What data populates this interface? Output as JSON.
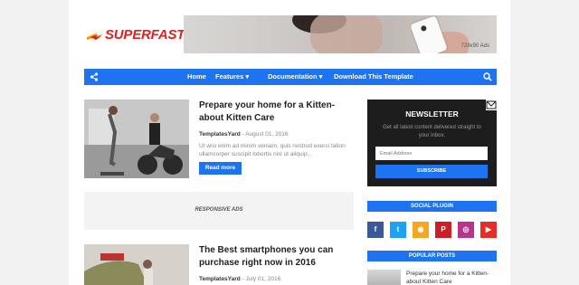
{
  "header": {
    "logo_text": "SUPERFAST",
    "banner_label": "728x90 Ads"
  },
  "nav": {
    "items": [
      "Home",
      "Features ▾",
      "Documentation ▾",
      "Download This Template"
    ]
  },
  "posts": [
    {
      "title": "Prepare your home for a Kitten-about Kitten Care",
      "author": "TemplatesYard",
      "date": "- August 01, 2016",
      "excerpt": "Ut wisi enim ad minim veniam, quis nostrud exerci tation ullamcorper suscipit lobortis nisl ut aliquip...",
      "read_more": "Read more"
    },
    {
      "title": "The Best smartphones you can purchase right now in 2016",
      "author": "TemplatesYard",
      "date": "- July 01, 2016"
    }
  ],
  "ads": {
    "label": "RESPONSIVE ADS"
  },
  "sidebar": {
    "newsletter": {
      "title": "NEWSLETTER",
      "description": "Get all latest content delivered straight to your inbox.",
      "placeholder": "Email Address",
      "button": "SUBSCRIBE"
    },
    "social_title": "SOCIAL PLUGIN",
    "social": [
      {
        "name": "facebook",
        "glyph": "f",
        "color": "#3b5998"
      },
      {
        "name": "twitter",
        "glyph": "t",
        "color": "#1da1f2"
      },
      {
        "name": "rss",
        "glyph": "◉",
        "color": "#f5a623"
      },
      {
        "name": "pinterest",
        "glyph": "P",
        "color": "#cb2027"
      },
      {
        "name": "instagram",
        "glyph": "◎",
        "color": "#b5358c"
      },
      {
        "name": "youtube",
        "glyph": "▶",
        "color": "#e52d27"
      }
    ],
    "popular_title": "POPULAR POSTS",
    "popular": [
      {
        "title": "Prepare your home for a Kitten-about Kitten Care"
      }
    ]
  }
}
